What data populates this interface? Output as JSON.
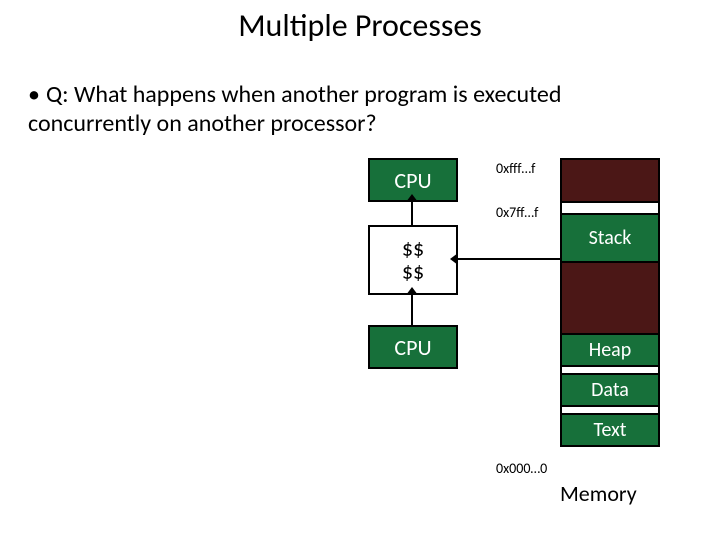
{
  "title": "Multiple Processes",
  "bullet": "Q: What happens when another program is executed concurrently on another processor?",
  "cpu_label": "CPU",
  "cache_label": "$$",
  "mem": {
    "stack": "Stack",
    "heap": "Heap",
    "data": "Data",
    "text": "Text",
    "label": "Memory"
  },
  "addr": {
    "top": "0xfff…f",
    "user": "0x7ff…f",
    "bottom": "0x000…0"
  }
}
